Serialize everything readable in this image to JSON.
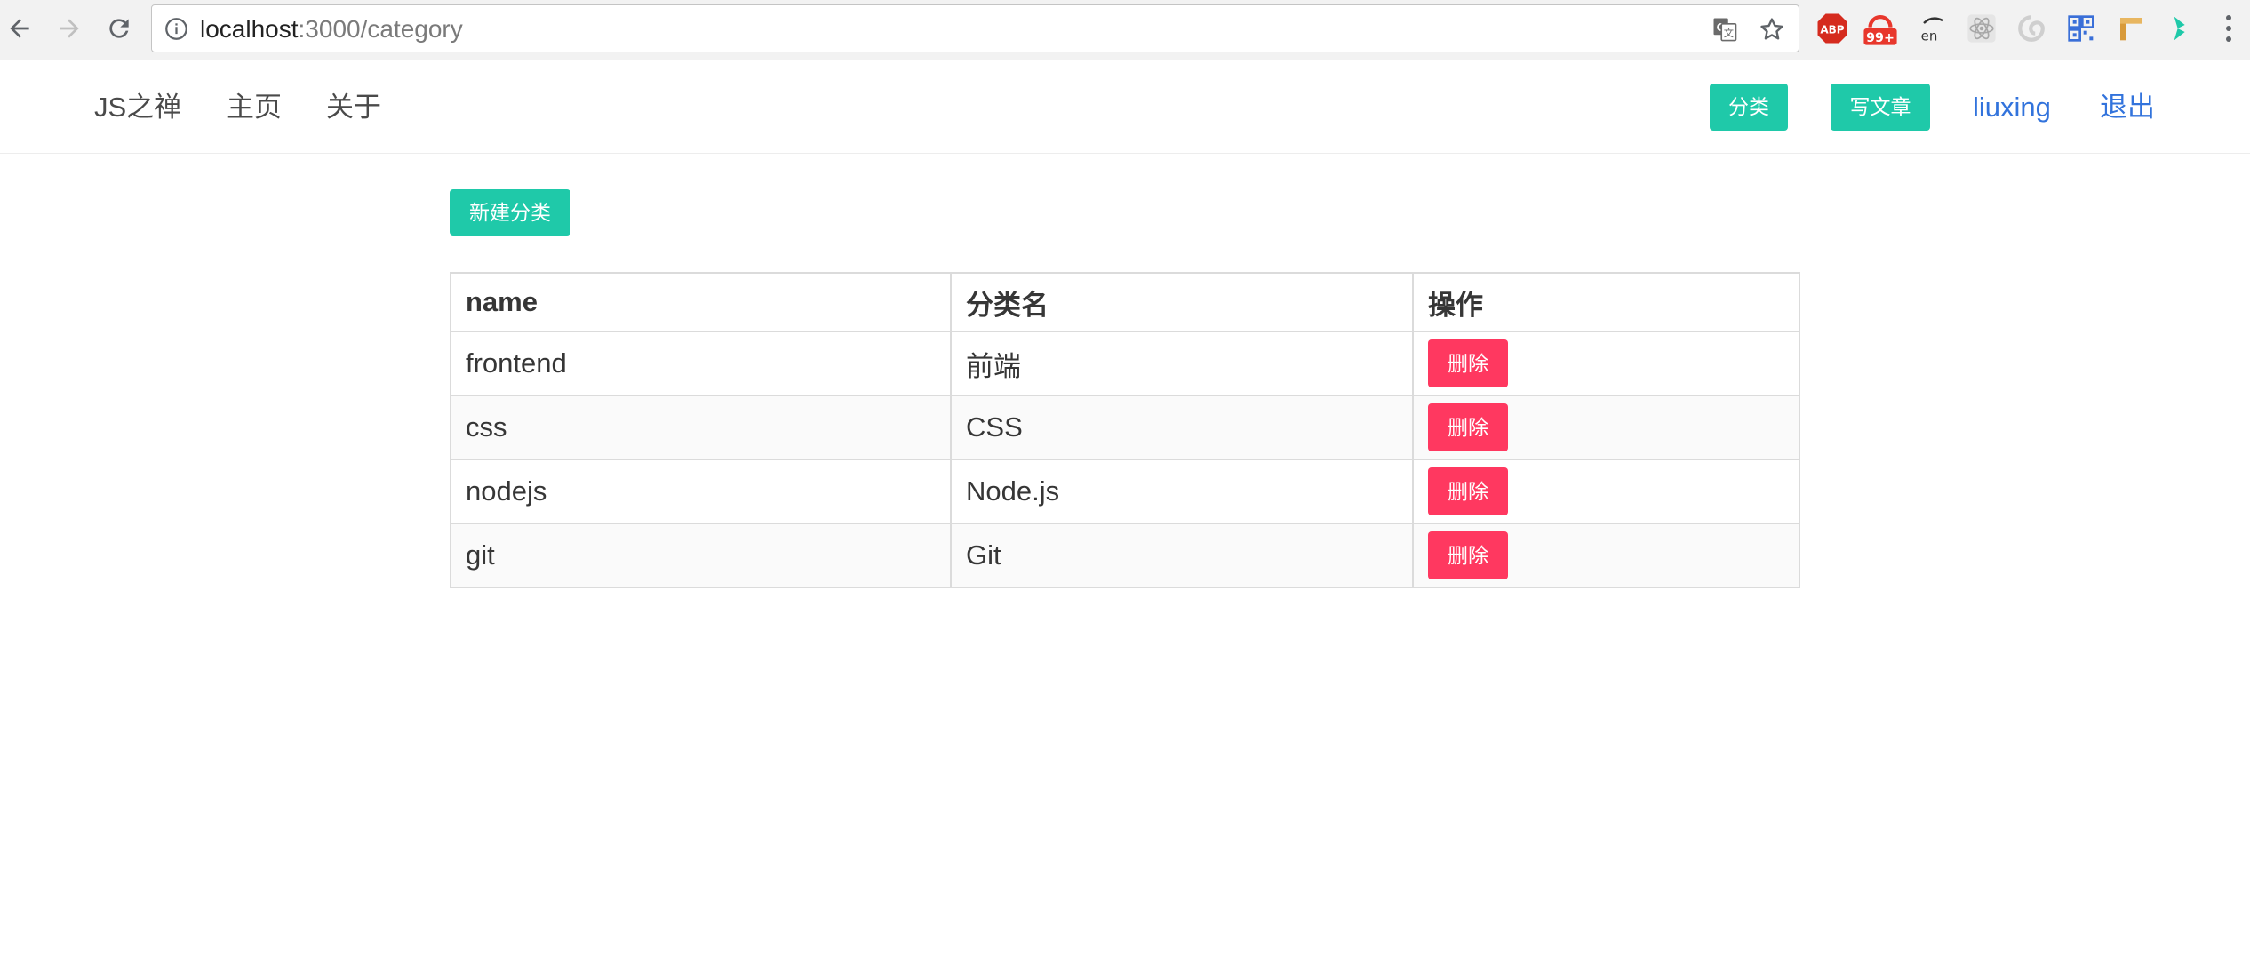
{
  "browser": {
    "url_host": "localhost",
    "url_path": ":3000/category",
    "extensions": [
      {
        "name": "adblock-plus-icon",
        "label": "ABP",
        "color": "#d52b1e"
      },
      {
        "name": "weibo-notify-icon",
        "label": "99+",
        "color": "#e8372c"
      },
      {
        "name": "translate-en-icon",
        "label": "en",
        "color": "#333333"
      },
      {
        "name": "react-devtools-icon",
        "label": "",
        "color": "#bdbdbd"
      },
      {
        "name": "gray-swirl-icon",
        "label": "",
        "color": "#cfcfcf"
      },
      {
        "name": "qr-code-icon",
        "label": "",
        "color": "#3a6fd8"
      },
      {
        "name": "ruler-icon",
        "label": "",
        "color": "#d89a3a"
      },
      {
        "name": "green-bolt-icon",
        "label": "",
        "color": "#1fc9a9"
      }
    ]
  },
  "navbar": {
    "brand": "JS之禅",
    "links": [
      "主页",
      "关于"
    ],
    "category_button": "分类",
    "write_button": "写文章",
    "username": "liuxing",
    "logout": "退出"
  },
  "content": {
    "new_category_button": "新建分类",
    "table": {
      "headers": [
        "name",
        "分类名",
        "操作"
      ],
      "rows": [
        {
          "name": "frontend",
          "title": "前端",
          "action": "删除"
        },
        {
          "name": "css",
          "title": "CSS",
          "action": "删除"
        },
        {
          "name": "nodejs",
          "title": "Node.js",
          "action": "删除"
        },
        {
          "name": "git",
          "title": "Git",
          "action": "删除"
        }
      ]
    }
  },
  "colors": {
    "accent_teal": "#1fc9a9",
    "danger": "#ff3860",
    "link_blue": "#3273dc"
  }
}
